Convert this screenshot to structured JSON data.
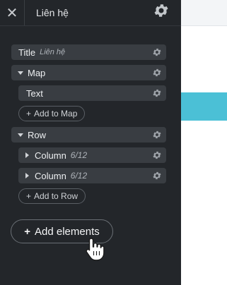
{
  "header": {
    "close_label": "✕",
    "title": "Liên hệ"
  },
  "tree": {
    "title_item": {
      "label": "Title",
      "sub": "Liên hệ"
    },
    "map_item": {
      "label": "Map"
    },
    "text_item": {
      "label": "Text"
    },
    "add_to_map": "Add to Map",
    "row_item": {
      "label": "Row"
    },
    "column_1": {
      "label": "Column",
      "count": "6/12"
    },
    "column_2": {
      "label": "Column",
      "count": "6/12"
    },
    "add_to_row": "Add to Row"
  },
  "footer": {
    "add_elements": "Add elements"
  },
  "colors": {
    "panel_bg": "#23262a",
    "item_bg": "#393d42",
    "preview_accent": "#4bc0d6"
  },
  "icons": [
    "close-icon",
    "gear-icon",
    "caret-down-icon",
    "caret-right-icon",
    "plus-icon",
    "hand-cursor-icon"
  ]
}
